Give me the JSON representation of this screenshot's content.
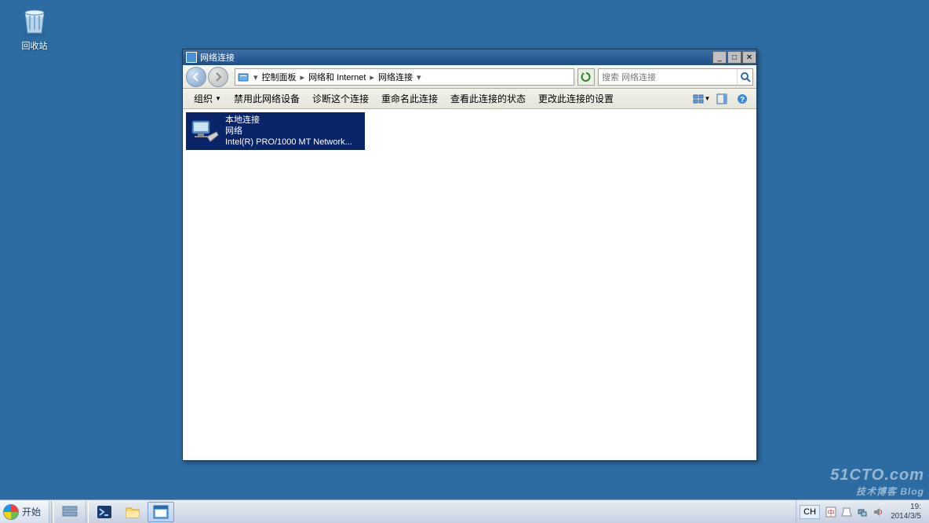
{
  "desktop": {
    "recycle_bin_label": "回收站"
  },
  "window": {
    "title": "网络连接",
    "breadcrumb": {
      "seg1": "控制面板",
      "seg2": "网络和 Internet",
      "seg3": "网络连接"
    },
    "search_placeholder": "搜索 网络连接",
    "toolbar": {
      "organize": "组织",
      "disable": "禁用此网络设备",
      "diagnose": "诊断这个连接",
      "rename": "重命名此连接",
      "status": "查看此连接的状态",
      "settings": "更改此连接的设置"
    },
    "connection": {
      "name": "本地连接",
      "status": "网络",
      "device": "Intel(R) PRO/1000 MT Network..."
    }
  },
  "taskbar": {
    "start": "开始",
    "lang": "CH",
    "time": "19:",
    "date": "2014/3/5"
  },
  "watermark": {
    "main": "51CTO.com",
    "sub": "技术博客 Blog"
  }
}
